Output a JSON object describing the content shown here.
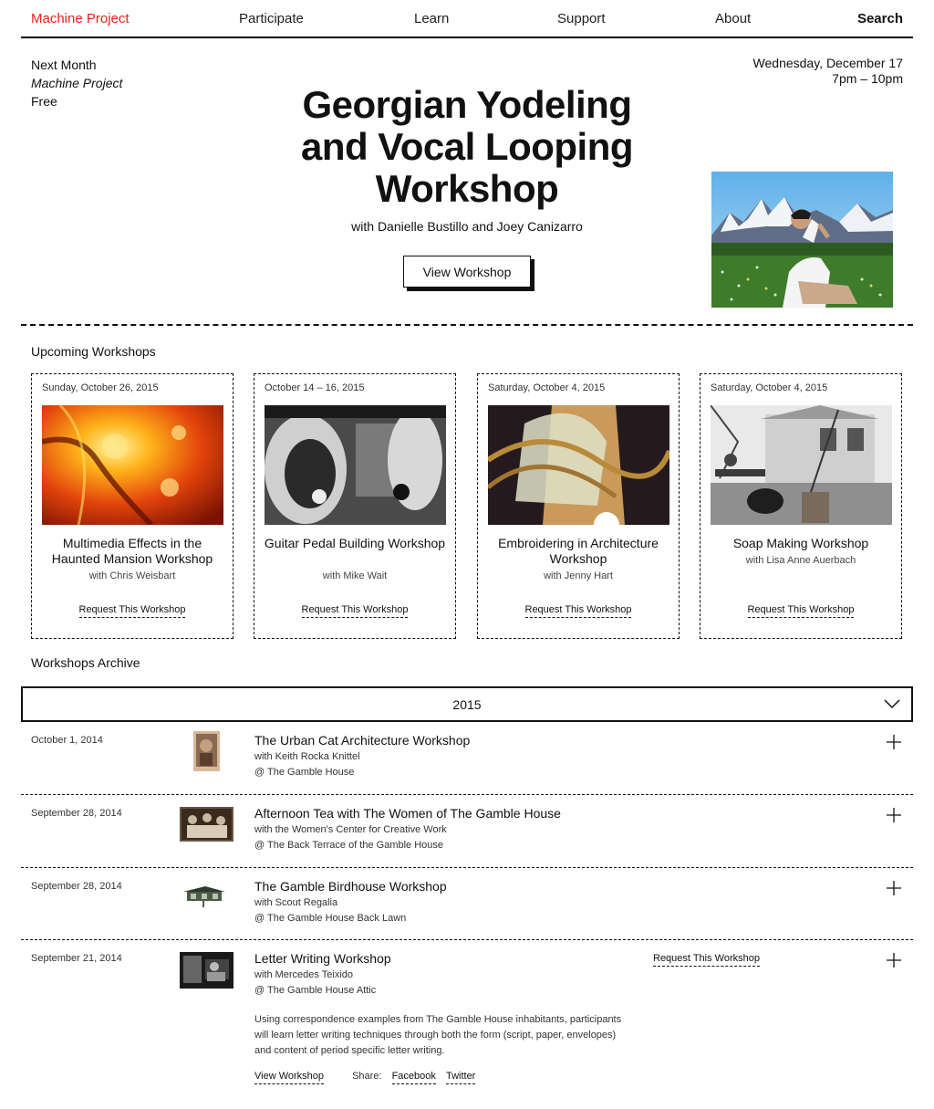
{
  "nav": {
    "brand": "Machine Project",
    "items": [
      "Participate",
      "Learn",
      "Support",
      "About"
    ],
    "search": "Search"
  },
  "hero": {
    "when": "Next Month",
    "venue": "Machine Project",
    "price": "Free",
    "date": "Wednesday, December 17",
    "time": "7pm – 10pm",
    "title": "Georgian Yodeling and Vocal Looping Workshop",
    "with": "with Danielle Bustillo and Joey Canizarro",
    "button": "View Workshop"
  },
  "upcoming": {
    "heading": "Upcoming Workshops",
    "cards": [
      {
        "date": "Sunday, October 26, 2015",
        "title": "Multimedia Effects in the Haunted Mansion Workshop",
        "with": "with Chris Weisbart",
        "request": "Request This Workshop"
      },
      {
        "date": "October 14 – 16, 2015",
        "title": "Guitar Pedal Building Workshop",
        "with": "with Mike Wait",
        "request": "Request This Workshop"
      },
      {
        "date": "Saturday, October 4, 2015",
        "title": "Embroidering in Architecture Workshop",
        "with": "with Jenny Hart",
        "request": "Request This Workshop"
      },
      {
        "date": "Saturday, October 4, 2015",
        "title": "Soap Making Workshop",
        "with": "with Lisa Anne Auerbach",
        "request": "Request This Workshop"
      }
    ]
  },
  "archive": {
    "heading": "Workshops Archive",
    "year": "2015",
    "rows": [
      {
        "date": "October 1, 2014",
        "title": "The Urban Cat Architecture Workshop",
        "with": "with Keith Rocka Knittel",
        "location": "@ The Gamble House"
      },
      {
        "date": "September 28, 2014",
        "title": "Afternoon Tea with The Women of The Gamble House",
        "with": "with the Women's Center for Creative Work",
        "location": "@ The Back Terrace of the Gamble House"
      },
      {
        "date": "September 28, 2014",
        "title": "The Gamble Birdhouse Workshop",
        "with": "with Scout Regalia",
        "location": "@ The Gamble House Back Lawn"
      },
      {
        "date": "September 21, 2014",
        "title": "Letter Writing Workshop",
        "with": "with Mercedes Teixido",
        "location": "@ The Gamble House Attic",
        "request": "Request This Workshop",
        "description": "Using correspondence examples from The Gamble House inhabitants, participants will learn letter writing techniques through both the form (script, paper, envelopes) and content of period specific letter writing.",
        "view": "View Workshop",
        "share": "Share:",
        "facebook": "Facebook",
        "twitter": "Twitter"
      }
    ]
  },
  "colors": {
    "brand": "#e0251b",
    "ink": "#111111"
  }
}
